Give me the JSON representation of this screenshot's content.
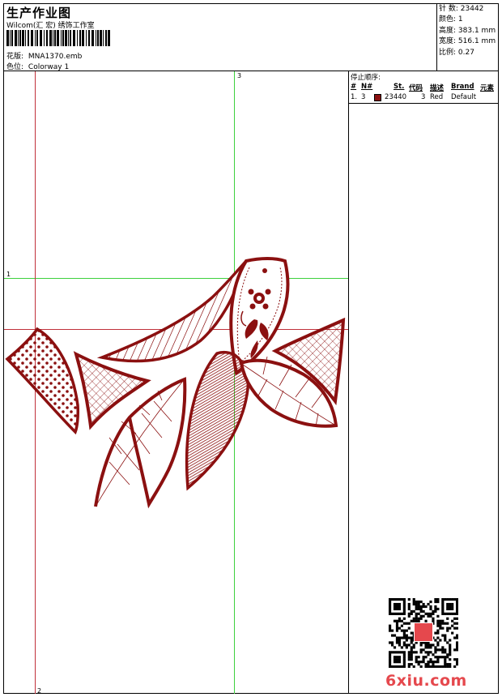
{
  "header": {
    "title": "生产作业图",
    "subtitle": "Wilcom(汇 宏) 绣饰工作室",
    "design_label": "花版:",
    "design_value": "MNA1370.emb",
    "colorway_label": "色位:",
    "colorway_value": "Colorway 1"
  },
  "stats": [
    {
      "label": "针 数:",
      "value": "23442"
    },
    {
      "label": "颜色:",
      "value": "1"
    },
    {
      "label": "高度:",
      "value": "383.1 mm"
    },
    {
      "label": "宽度:",
      "value": "516.1 mm"
    },
    {
      "label": "比例:",
      "value": "0.27"
    }
  ],
  "stop_sequence": {
    "title": "停止顺序:",
    "columns": [
      "#",
      "N#",
      "St.",
      "代码",
      "描述",
      "Brand",
      "元素"
    ],
    "rows": [
      {
        "index": "1.",
        "n": "3",
        "color": "#8b1010",
        "stitches": "23440",
        "code": "3",
        "description": "Red",
        "brand": "Default",
        "element": ""
      }
    ]
  },
  "guides": {
    "top_label": "3",
    "left_label": "1",
    "bottom_label": "2"
  },
  "embroidery": {
    "thread_color": "#8b1010"
  },
  "watermark": "6xiu.com"
}
